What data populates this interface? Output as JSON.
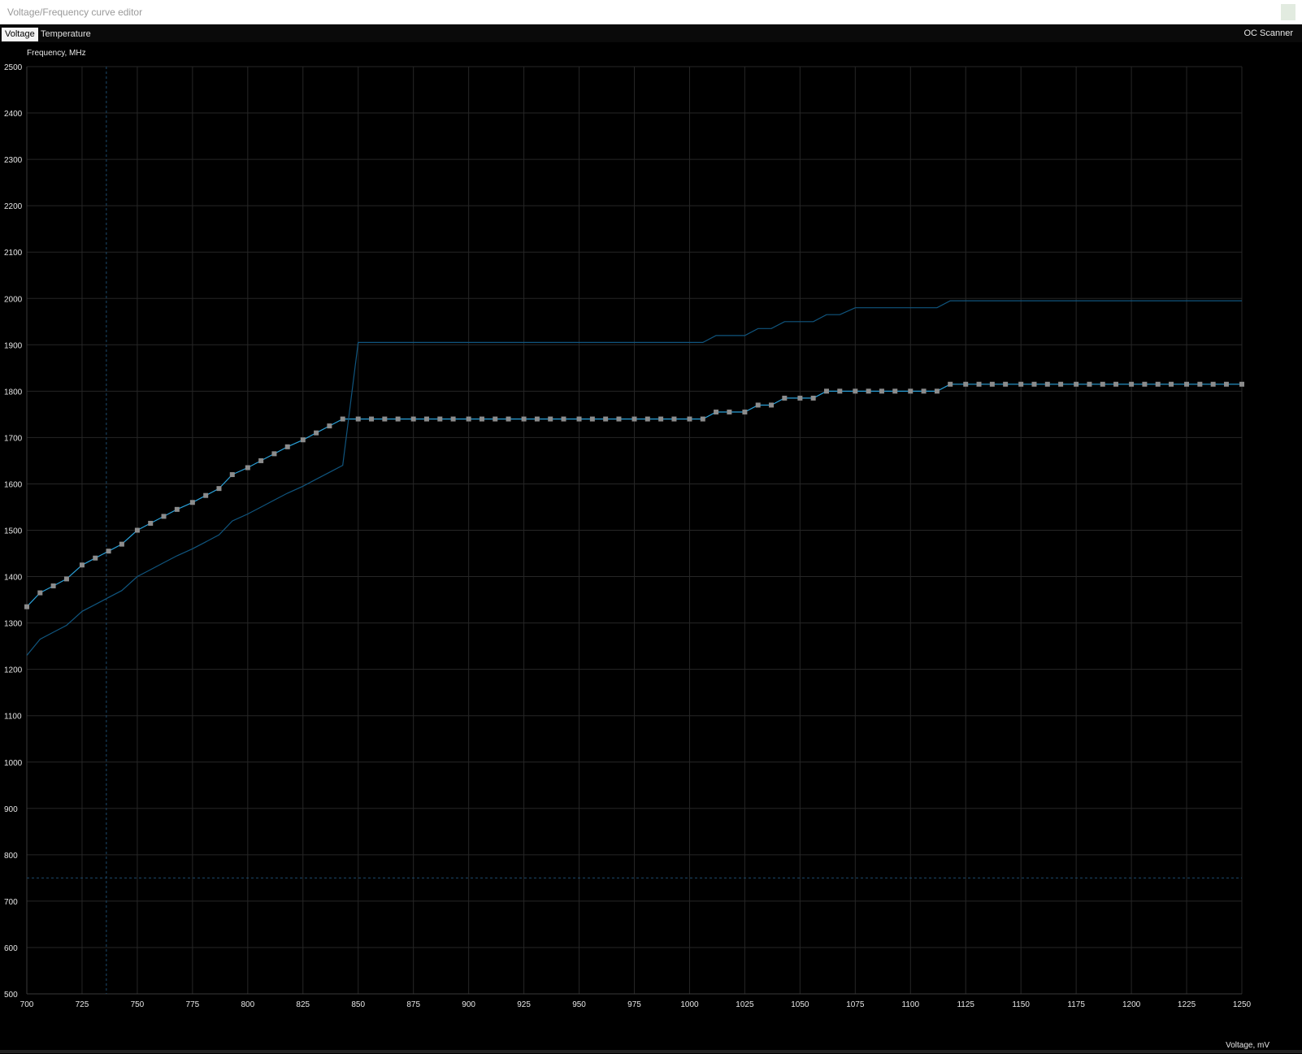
{
  "window": {
    "title": "Voltage/Frequency curve editor"
  },
  "tabs": [
    {
      "label": "Voltage",
      "active": true
    },
    {
      "label": "Temperature",
      "active": false
    }
  ],
  "oc_scanner_label": "OC Scanner",
  "chart_data": {
    "type": "line",
    "ylabel": "Frequency, MHz",
    "xlabel": "Voltage, mV",
    "xlim": [
      700,
      1250
    ],
    "ylim": [
      500,
      2500
    ],
    "x_ticks": [
      700,
      725,
      750,
      775,
      800,
      825,
      850,
      875,
      900,
      925,
      950,
      975,
      1000,
      1025,
      1050,
      1075,
      1100,
      1125,
      1150,
      1175,
      1200,
      1225,
      1250
    ],
    "y_ticks": [
      500,
      600,
      700,
      800,
      900,
      1000,
      1100,
      1200,
      1300,
      1400,
      1500,
      1600,
      1700,
      1800,
      1900,
      2000,
      2100,
      2200,
      2300,
      2400,
      2500
    ],
    "grid": true,
    "colors": {
      "curve": "#2aa0d8",
      "reference": "#10557e",
      "grid": "#262626",
      "marker": "#8c8c8c",
      "cursor": "#1c4a6c"
    },
    "cursor": {
      "voltage": 736,
      "frequency": 750
    },
    "series": [
      {
        "role": "edited-curve",
        "markers": true,
        "points": [
          [
            700,
            1335
          ],
          [
            706,
            1365
          ],
          [
            712,
            1380
          ],
          [
            718,
            1395
          ],
          [
            725,
            1425
          ],
          [
            731,
            1440
          ],
          [
            737,
            1455
          ],
          [
            743,
            1470
          ],
          [
            750,
            1500
          ],
          [
            756,
            1515
          ],
          [
            762,
            1530
          ],
          [
            768,
            1545
          ],
          [
            775,
            1560
          ],
          [
            781,
            1575
          ],
          [
            787,
            1590
          ],
          [
            793,
            1620
          ],
          [
            800,
            1635
          ],
          [
            806,
            1650
          ],
          [
            812,
            1665
          ],
          [
            818,
            1680
          ],
          [
            825,
            1695
          ],
          [
            831,
            1710
          ],
          [
            837,
            1725
          ],
          [
            843,
            1740
          ],
          [
            850,
            1740
          ],
          [
            856,
            1740
          ],
          [
            862,
            1740
          ],
          [
            868,
            1740
          ],
          [
            875,
            1740
          ],
          [
            881,
            1740
          ],
          [
            887,
            1740
          ],
          [
            893,
            1740
          ],
          [
            900,
            1740
          ],
          [
            906,
            1740
          ],
          [
            912,
            1740
          ],
          [
            918,
            1740
          ],
          [
            925,
            1740
          ],
          [
            931,
            1740
          ],
          [
            937,
            1740
          ],
          [
            943,
            1740
          ],
          [
            950,
            1740
          ],
          [
            956,
            1740
          ],
          [
            962,
            1740
          ],
          [
            968,
            1740
          ],
          [
            975,
            1740
          ],
          [
            981,
            1740
          ],
          [
            987,
            1740
          ],
          [
            993,
            1740
          ],
          [
            1000,
            1740
          ],
          [
            1006,
            1740
          ],
          [
            1012,
            1755
          ],
          [
            1018,
            1755
          ],
          [
            1025,
            1755
          ],
          [
            1031,
            1770
          ],
          [
            1037,
            1770
          ],
          [
            1043,
            1785
          ],
          [
            1050,
            1785
          ],
          [
            1056,
            1785
          ],
          [
            1062,
            1800
          ],
          [
            1068,
            1800
          ],
          [
            1075,
            1800
          ],
          [
            1081,
            1800
          ],
          [
            1087,
            1800
          ],
          [
            1093,
            1800
          ],
          [
            1100,
            1800
          ],
          [
            1106,
            1800
          ],
          [
            1112,
            1800
          ],
          [
            1118,
            1815
          ],
          [
            1125,
            1815
          ],
          [
            1131,
            1815
          ],
          [
            1137,
            1815
          ],
          [
            1143,
            1815
          ],
          [
            1150,
            1815
          ],
          [
            1156,
            1815
          ],
          [
            1162,
            1815
          ],
          [
            1168,
            1815
          ],
          [
            1175,
            1815
          ],
          [
            1181,
            1815
          ],
          [
            1187,
            1815
          ],
          [
            1193,
            1815
          ],
          [
            1200,
            1815
          ],
          [
            1206,
            1815
          ],
          [
            1212,
            1815
          ],
          [
            1218,
            1815
          ],
          [
            1225,
            1815
          ],
          [
            1231,
            1815
          ],
          [
            1237,
            1815
          ],
          [
            1243,
            1815
          ],
          [
            1250,
            1815
          ]
        ]
      },
      {
        "role": "reference-curve",
        "markers": false,
        "points": [
          [
            700,
            1230
          ],
          [
            706,
            1265
          ],
          [
            712,
            1280
          ],
          [
            718,
            1295
          ],
          [
            725,
            1325
          ],
          [
            731,
            1340
          ],
          [
            737,
            1355
          ],
          [
            743,
            1370
          ],
          [
            750,
            1400
          ],
          [
            756,
            1415
          ],
          [
            762,
            1430
          ],
          [
            768,
            1445
          ],
          [
            775,
            1460
          ],
          [
            781,
            1475
          ],
          [
            787,
            1490
          ],
          [
            793,
            1520
          ],
          [
            800,
            1535
          ],
          [
            806,
            1550
          ],
          [
            812,
            1565
          ],
          [
            818,
            1580
          ],
          [
            825,
            1595
          ],
          [
            831,
            1610
          ],
          [
            837,
            1625
          ],
          [
            843,
            1640
          ],
          [
            850,
            1905
          ],
          [
            856,
            1905
          ],
          [
            900,
            1905
          ],
          [
            950,
            1905
          ],
          [
            1000,
            1905
          ],
          [
            1006,
            1905
          ],
          [
            1012,
            1920
          ],
          [
            1018,
            1920
          ],
          [
            1025,
            1920
          ],
          [
            1031,
            1935
          ],
          [
            1037,
            1935
          ],
          [
            1043,
            1950
          ],
          [
            1050,
            1950
          ],
          [
            1056,
            1950
          ],
          [
            1062,
            1965
          ],
          [
            1068,
            1965
          ],
          [
            1075,
            1980
          ],
          [
            1081,
            1980
          ],
          [
            1087,
            1980
          ],
          [
            1093,
            1980
          ],
          [
            1100,
            1980
          ],
          [
            1106,
            1980
          ],
          [
            1112,
            1980
          ],
          [
            1118,
            1995
          ],
          [
            1125,
            1995
          ],
          [
            1150,
            1995
          ],
          [
            1200,
            1995
          ],
          [
            1250,
            1995
          ]
        ]
      }
    ]
  }
}
